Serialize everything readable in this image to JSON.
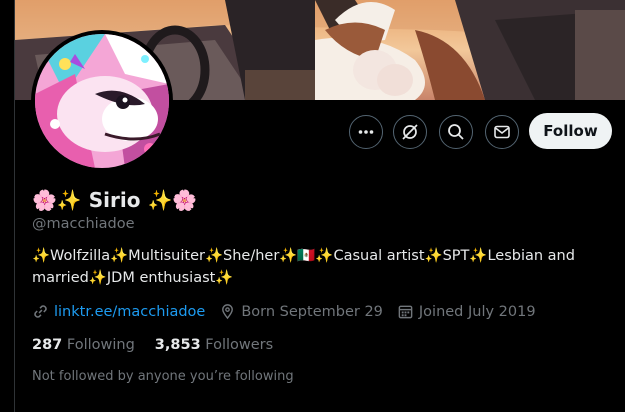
{
  "profile": {
    "name": "🌸✨ Sirio ✨🌸",
    "handle": "@macchiadoe",
    "bio": "✨Wolfzilla✨Multisuiter✨She/her✨🇲🇽✨Casual artist✨SPT✨Lesbian and married✨JDM enthusiast✨",
    "link": "linktr.ee/macchiadoe",
    "born": "Born September 29",
    "joined": "Joined July 2019"
  },
  "stats": {
    "following_count": "287",
    "following_label": "Following",
    "followers_count": "3,853",
    "followers_label": "Followers"
  },
  "follow_context": "Not followed by anyone you’re following",
  "actions": {
    "follow_label": "Follow",
    "icons": [
      "more-icon",
      "grok-icon",
      "search-icon",
      "message-icon"
    ]
  },
  "colors": {
    "accent_link": "#1d9bf0",
    "muted_text": "#71767b",
    "follow_bg": "#eff3f4"
  }
}
